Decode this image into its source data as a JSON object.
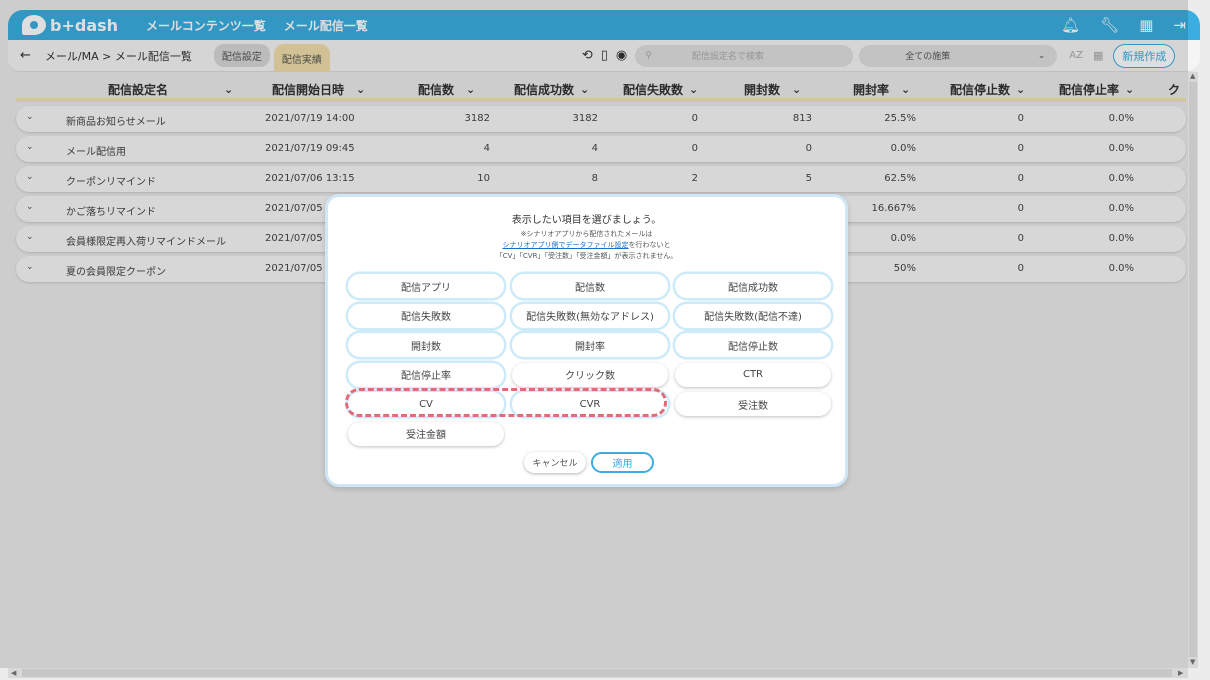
{
  "header": {
    "logo": "b+dash",
    "nav": [
      "メールコンテンツ一覧",
      "メール配信一覧"
    ],
    "icons": [
      "bell-icon",
      "wrench-icon",
      "grid-icon",
      "logout-icon"
    ]
  },
  "subbar": {
    "back": "←",
    "breadcrumb": "メール/MA > メール配信一覧",
    "tab_settings": "配信設定",
    "tab_results": "配信実績",
    "search_placeholder": "配信設定名で検索",
    "filter": "全ての施策",
    "sort_label": "AZ",
    "new_button": "新規作成"
  },
  "table": {
    "headers": [
      "配信設定名",
      "配信開始日時",
      "配信数",
      "配信成功数",
      "配信失敗数",
      "開封数",
      "開封率",
      "配信停止数",
      "配信停止率",
      "ク"
    ],
    "rows": [
      {
        "name": "新商品お知らせメール",
        "date": "2021/07/19 14:00",
        "sent": "3182",
        "success": "3182",
        "fail": "0",
        "open": "813",
        "rate": "25.5%",
        "stop": "0",
        "stoprate": "0.0%"
      },
      {
        "name": "メール配信用",
        "date": "2021/07/19 09:45",
        "sent": "4",
        "success": "4",
        "fail": "0",
        "open": "0",
        "rate": "0.0%",
        "stop": "0",
        "stoprate": "0.0%"
      },
      {
        "name": "クーポンリマインド",
        "date": "2021/07/06 13:15",
        "sent": "10",
        "success": "8",
        "fail": "2",
        "open": "5",
        "rate": "62.5%",
        "stop": "0",
        "stoprate": "0.0%"
      },
      {
        "name": "かご落ちリマインド",
        "date": "2021/07/05",
        "sent": "",
        "success": "",
        "fail": "",
        "open": "",
        "rate": "16.667%",
        "stop": "0",
        "stoprate": "0.0%"
      },
      {
        "name": "会員様限定再入荷リマインドメール",
        "date": "2021/07/05",
        "sent": "",
        "success": "",
        "fail": "",
        "open": "",
        "rate": "0.0%",
        "stop": "0",
        "stoprate": "0.0%"
      },
      {
        "name": "夏の会員限定クーポン",
        "date": "2021/07/05",
        "sent": "",
        "success": "",
        "fail": "",
        "open": "",
        "rate": "50%",
        "stop": "0",
        "stoprate": "0.0%"
      }
    ]
  },
  "modal": {
    "title": "表示したい項目を選びましょう。",
    "note1": "※シナリオアプリから配信されたメールは",
    "note_link": "シナリオアプリ側でデータファイル設定",
    "note2_tail": "を行わないと",
    "note3": "「CV」「CVR」「受注数」「受注金額」が表示されません。",
    "options": [
      {
        "label": "配信アプリ",
        "selected": true
      },
      {
        "label": "配信数",
        "selected": true
      },
      {
        "label": "配信成功数",
        "selected": true
      },
      {
        "label": "配信失敗数",
        "selected": true
      },
      {
        "label": "配信失敗数(無効なアドレス)",
        "selected": true
      },
      {
        "label": "配信失敗数(配信不達)",
        "selected": true
      },
      {
        "label": "開封数",
        "selected": true
      },
      {
        "label": "開封率",
        "selected": true
      },
      {
        "label": "配信停止数",
        "selected": true
      },
      {
        "label": "配信停止率",
        "selected": true
      },
      {
        "label": "クリック数",
        "selected": false
      },
      {
        "label": "CTR",
        "selected": false
      },
      {
        "label": "CV",
        "selected": true
      },
      {
        "label": "CVR",
        "selected": true
      },
      {
        "label": "受注数",
        "selected": false
      },
      {
        "label": "受注金額",
        "selected": false
      }
    ],
    "cancel": "キャンセル",
    "apply": "適用"
  }
}
